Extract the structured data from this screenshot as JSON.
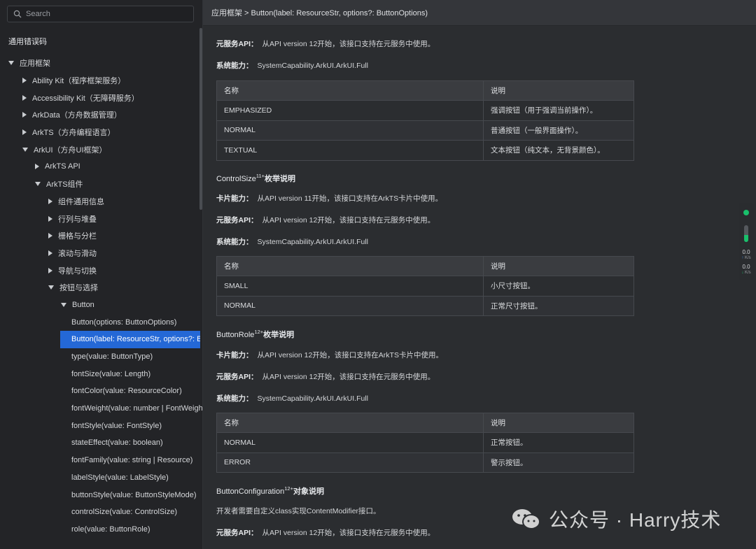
{
  "search": {
    "placeholder": "Search"
  },
  "sidebar": {
    "section_title": "通用错误码",
    "tree": [
      {
        "label": "应用框架",
        "level": 0,
        "state": "open"
      },
      {
        "label": "Ability Kit（程序框架服务）",
        "level": 1,
        "state": "closed"
      },
      {
        "label": "Accessibility Kit（无障碍服务）",
        "level": 1,
        "state": "closed"
      },
      {
        "label": "ArkData（方舟数据管理）",
        "level": 1,
        "state": "closed"
      },
      {
        "label": "ArkTS（方舟编程语言）",
        "level": 1,
        "state": "closed"
      },
      {
        "label": "ArkUI（方舟UI框架）",
        "level": 1,
        "state": "open"
      },
      {
        "label": "ArkTS API",
        "level": 2,
        "state": "closed"
      },
      {
        "label": "ArkTS组件",
        "level": 2,
        "state": "open"
      },
      {
        "label": "组件通用信息",
        "level": 3,
        "state": "closed"
      },
      {
        "label": "行列与堆叠",
        "level": 3,
        "state": "closed"
      },
      {
        "label": "栅格与分栏",
        "level": 3,
        "state": "closed"
      },
      {
        "label": "滚动与滑动",
        "level": 3,
        "state": "closed"
      },
      {
        "label": "导航与切换",
        "level": 3,
        "state": "closed"
      },
      {
        "label": "按钮与选择",
        "level": 3,
        "state": "open"
      },
      {
        "label": "Button",
        "level": 4,
        "state": "open"
      },
      {
        "label": "Button(options: ButtonOptions)",
        "level": 5,
        "state": "leaf"
      },
      {
        "label": "Button(label: ResourceStr, options?: Bu",
        "level": 5,
        "state": "leaf",
        "selected": true
      },
      {
        "label": "type(value: ButtonType)",
        "level": 5,
        "state": "leaf"
      },
      {
        "label": "fontSize(value: Length)",
        "level": 5,
        "state": "leaf"
      },
      {
        "label": "fontColor(value: ResourceColor)",
        "level": 5,
        "state": "leaf"
      },
      {
        "label": "fontWeight(value: number | FontWeigh",
        "level": 5,
        "state": "leaf"
      },
      {
        "label": "fontStyle(value: FontStyle)",
        "level": 5,
        "state": "leaf"
      },
      {
        "label": "stateEffect(value: boolean)",
        "level": 5,
        "state": "leaf"
      },
      {
        "label": "fontFamily(value: string | Resource)",
        "level": 5,
        "state": "leaf"
      },
      {
        "label": "labelStyle(value: LabelStyle)",
        "level": 5,
        "state": "leaf"
      },
      {
        "label": "buttonStyle(value: ButtonStyleMode)",
        "level": 5,
        "state": "leaf"
      },
      {
        "label": "controlSize(value: ControlSize)",
        "level": 5,
        "state": "leaf"
      },
      {
        "label": "role(value: ButtonRole)",
        "level": 5,
        "state": "leaf"
      }
    ]
  },
  "breadcrumb": "应用框架 > Button(label: ResourceStr, options?: ButtonOptions)",
  "doc": {
    "block1": {
      "meta_label": "元服务API：",
      "meta_text": "从API version 12开始，该接口支持在元服务中使用。",
      "sys_label": "系统能力：",
      "sys_text": "SystemCapability.ArkUI.ArkUI.Full",
      "headers": [
        "名称",
        "说明"
      ],
      "rows": [
        [
          "EMPHASIZED",
          "强调按钮（用于强调当前操作）。"
        ],
        [
          "NORMAL",
          "普通按钮（一般界面操作）。"
        ],
        [
          "TEXTUAL",
          "文本按钮（纯文本，无背景颜色）。"
        ]
      ]
    },
    "block2": {
      "title": "ControlSize",
      "sup": "11+",
      "title_suffix": "枚举说明",
      "card_label": "卡片能力：",
      "card_text": "从API version 11开始，该接口支持在ArkTS卡片中使用。",
      "meta_label": "元服务API：",
      "meta_text": "从API version 12开始，该接口支持在元服务中使用。",
      "sys_label": "系统能力：",
      "sys_text": "SystemCapability.ArkUI.ArkUI.Full",
      "headers": [
        "名称",
        "说明"
      ],
      "rows": [
        [
          "SMALL",
          "小尺寸按钮。"
        ],
        [
          "NORMAL",
          "正常尺寸按钮。"
        ]
      ]
    },
    "block3": {
      "title": "ButtonRole",
      "sup": "12+",
      "title_suffix": "枚举说明",
      "card_label": "卡片能力：",
      "card_text": "从API version 12开始，该接口支持在ArkTS卡片中使用。",
      "meta_label": "元服务API：",
      "meta_text": "从API version 12开始，该接口支持在元服务中使用。",
      "sys_label": "系统能力：",
      "sys_text": "SystemCapability.ArkUI.ArkUI.Full",
      "headers": [
        "名称",
        "说明"
      ],
      "rows": [
        [
          "NORMAL",
          "正常按钮。"
        ],
        [
          "ERROR",
          "警示按钮。"
        ]
      ]
    },
    "block4": {
      "title": "ButtonConfiguration",
      "sup": "12+",
      "title_suffix": "对象说明",
      "desc": "开发者需要自定义class实现ContentModifier接口。",
      "meta_label": "元服务API：",
      "meta_text": "从API version 12开始，该接口支持在元服务中使用。"
    }
  },
  "net_widget": {
    "up_value": "0.0",
    "up_unit": "K/s",
    "down_value": "0.0",
    "down_unit": "K/s",
    "status_color": "#19c06b"
  },
  "watermark": {
    "text": "公众号 · Harry技术"
  },
  "colors": {
    "selected": "#2468d6",
    "sidebar_bg": "#232427",
    "main_bg": "#2b2d30"
  }
}
